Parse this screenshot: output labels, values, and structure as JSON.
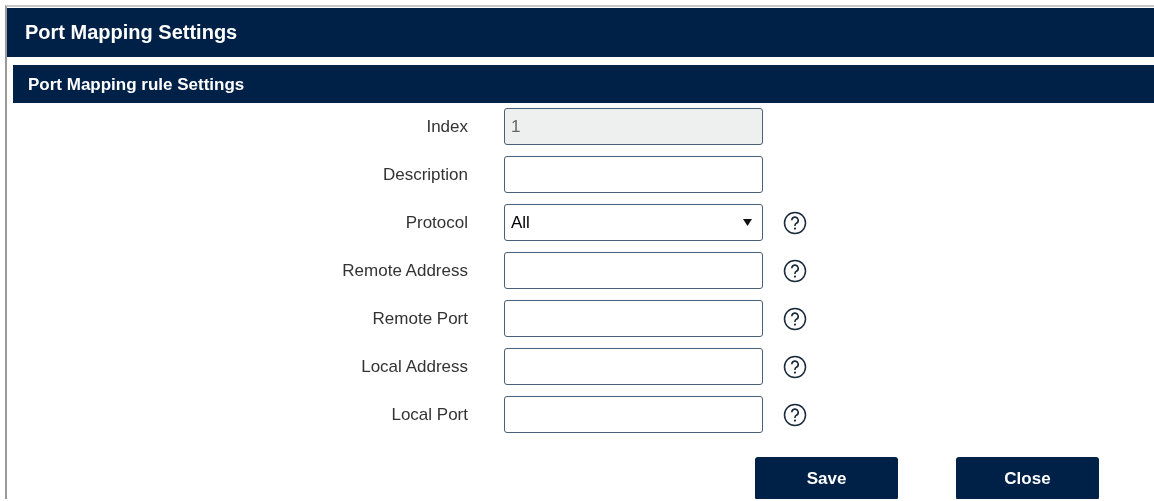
{
  "window": {
    "title": "Port Mapping Settings"
  },
  "section": {
    "title": "Port Mapping rule Settings"
  },
  "fields": [
    {
      "label": "Index",
      "kind": "text",
      "value": "1",
      "disabled": true,
      "help": false
    },
    {
      "label": "Description",
      "kind": "text",
      "disabled": false,
      "help": false
    },
    {
      "label": "Protocol",
      "kind": "select",
      "value": "All",
      "disabled": false,
      "help": true
    },
    {
      "label": "Remote Address",
      "kind": "text",
      "disabled": false,
      "help": true
    },
    {
      "label": "Remote Port",
      "kind": "text",
      "disabled": false,
      "help": true
    },
    {
      "label": "Local Address",
      "kind": "text",
      "disabled": false,
      "help": true
    },
    {
      "label": "Local Port",
      "kind": "text",
      "disabled": false,
      "help": true
    }
  ],
  "buttons": [
    "Save",
    "Close"
  ]
}
